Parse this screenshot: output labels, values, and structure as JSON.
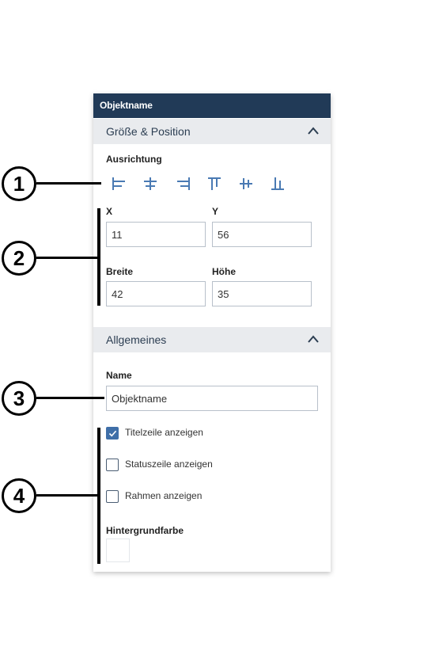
{
  "panel": {
    "title": "Objektname",
    "section_size_position": {
      "label": "Größe & Position",
      "alignment_label": "Ausrichtung",
      "alignment_icons": [
        "align-left-icon",
        "align-center-horizontal-icon",
        "align-right-icon",
        "align-top-icon",
        "align-center-vertical-icon",
        "align-bottom-icon"
      ],
      "x_label": "X",
      "x_value": "11",
      "y_label": "Y",
      "y_value": "56",
      "width_label": "Breite",
      "width_value": "42",
      "height_label": "Höhe",
      "height_value": "35"
    },
    "section_general": {
      "label": "Allgemeines",
      "name_label": "Name",
      "name_value": "Objektname",
      "checkboxes": [
        {
          "label": "Titelzeile anzeigen",
          "checked": true
        },
        {
          "label": "Statuszeile anzeigen",
          "checked": false
        },
        {
          "label": "Rahmen anzeigen",
          "checked": false
        }
      ],
      "background_color_label": "Hintergrundfarbe",
      "background_color_value": "#ffffff"
    }
  },
  "callouts": [
    "1",
    "2",
    "3",
    "4"
  ],
  "colors": {
    "titlebar": "#213a57",
    "section_header": "#e9ebee",
    "accent": "#3f6fa8",
    "icon": "#4a7ab3"
  }
}
